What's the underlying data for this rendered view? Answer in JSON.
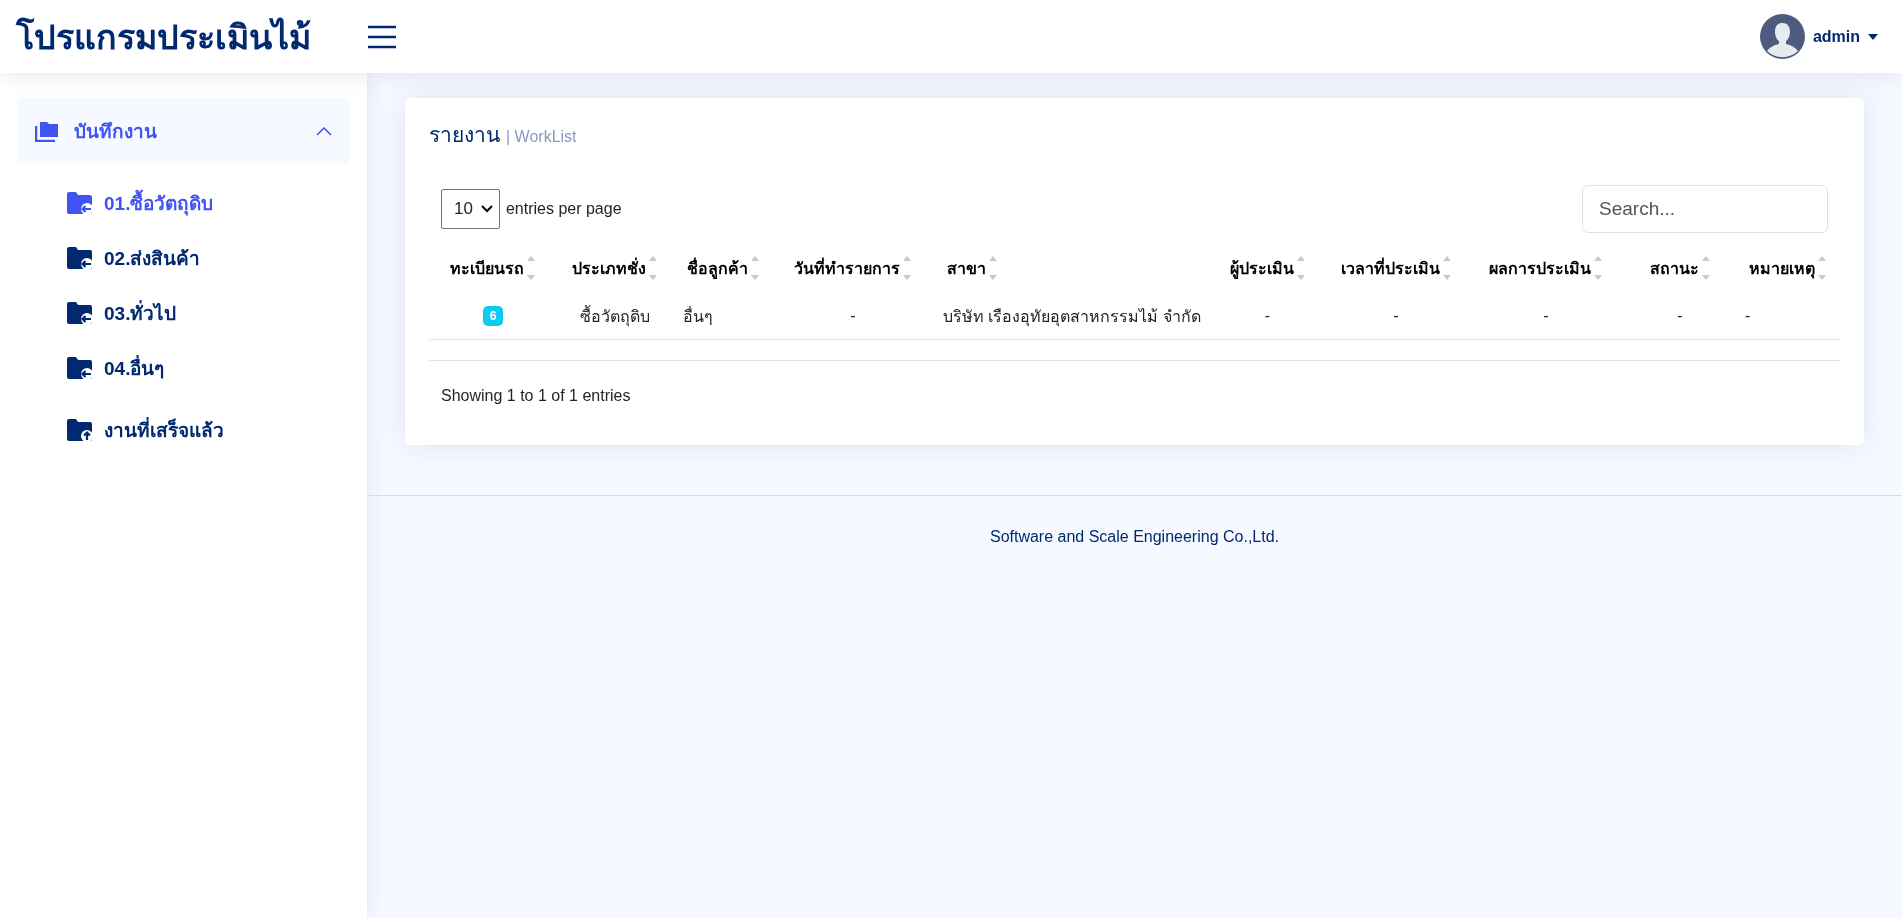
{
  "header": {
    "title": "โปรแกรมประเมินไม้",
    "user": "admin"
  },
  "sidebar": {
    "group": {
      "label": "บันทึกงาน",
      "expanded": true,
      "children": [
        {
          "label": "01.ซื้อวัตถุดิบ",
          "selected": true
        },
        {
          "label": "02.ส่งสินค้า",
          "selected": false
        },
        {
          "label": "03.ทั่วไป",
          "selected": false
        },
        {
          "label": "04.อื่นๆ",
          "selected": false
        },
        {
          "label": "งานที่เสร็จแล้ว",
          "selected": false
        }
      ]
    }
  },
  "card": {
    "title": "รายงาน",
    "subtitle": "| WorkList",
    "page_size": "10",
    "page_size_label": "entries per page",
    "search": {
      "placeholder": "Search..."
    },
    "table": {
      "columns": [
        {
          "label": "ทะเบียนรถ"
        },
        {
          "label": "ประเภทชั่ง"
        },
        {
          "label": "ชื่อลูกค้า"
        },
        {
          "label": "วันที่ทำรายการ"
        },
        {
          "label": "สาขา"
        },
        {
          "label": "ผู้ประเมิน"
        },
        {
          "label": "เวลาที่ประเมิน"
        },
        {
          "label": "ผลการประเมิน"
        },
        {
          "label": "สถานะ"
        },
        {
          "label": "หมายเหตุ"
        }
      ],
      "rows": [
        {
          "cells": [
            {
              "kind": "badge",
              "text": "6"
            },
            {
              "kind": "text",
              "text": "ซื้อวัตถุดิบ"
            },
            {
              "kind": "text",
              "text": "อื่นๆ"
            },
            {
              "kind": "text",
              "text": "-"
            },
            {
              "kind": "text",
              "text": "บริษัท เรืองอุทัยอุตสาหกรรมไม้ จำกัด"
            },
            {
              "kind": "text",
              "text": "-"
            },
            {
              "kind": "text",
              "text": "-"
            },
            {
              "kind": "text",
              "text": "-"
            },
            {
              "kind": "text",
              "text": "-"
            },
            {
              "kind": "text",
              "text": "-"
            }
          ]
        }
      ]
    },
    "info": "Showing 1 to 1 of 1 entries"
  },
  "footer": "Software and Scale Engineering Co.,Ltd."
}
